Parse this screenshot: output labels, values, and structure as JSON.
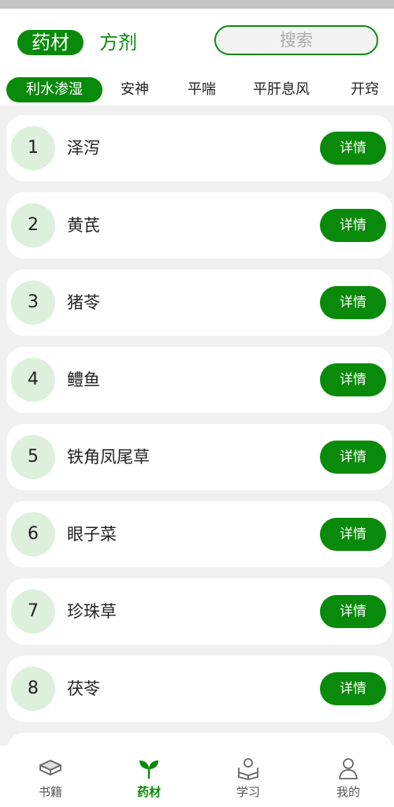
{
  "header": {
    "segments": [
      {
        "label": "药材"
      },
      {
        "label": "方剂"
      }
    ],
    "search_placeholder": "搜索"
  },
  "categories": [
    "利水渗湿",
    "安神",
    "平喘",
    "平肝息风",
    "开窍"
  ],
  "items": [
    {
      "no": "1",
      "name": "泽泻",
      "action": "详情"
    },
    {
      "no": "2",
      "name": "黄芪",
      "action": "详情"
    },
    {
      "no": "3",
      "name": "猪苓",
      "action": "详情"
    },
    {
      "no": "4",
      "name": "鳢鱼",
      "action": "详情"
    },
    {
      "no": "5",
      "name": "铁角凤尾草",
      "action": "详情"
    },
    {
      "no": "6",
      "name": "眼子菜",
      "action": "详情"
    },
    {
      "no": "7",
      "name": "珍珠草",
      "action": "详情"
    },
    {
      "no": "8",
      "name": "茯苓",
      "action": "详情"
    }
  ],
  "tabbar": {
    "tabs": [
      {
        "label": "书籍",
        "icon": "book-icon"
      },
      {
        "label": "药材",
        "icon": "leaf-sprout-icon"
      },
      {
        "label": "学习",
        "icon": "reading-person-icon"
      },
      {
        "label": "我的",
        "icon": "user-icon"
      }
    ],
    "active_index": 1
  },
  "colors": {
    "accent": "#0a8a0a",
    "number_bg": "#dcf0dc",
    "page_bg": "#f0f0f0"
  }
}
